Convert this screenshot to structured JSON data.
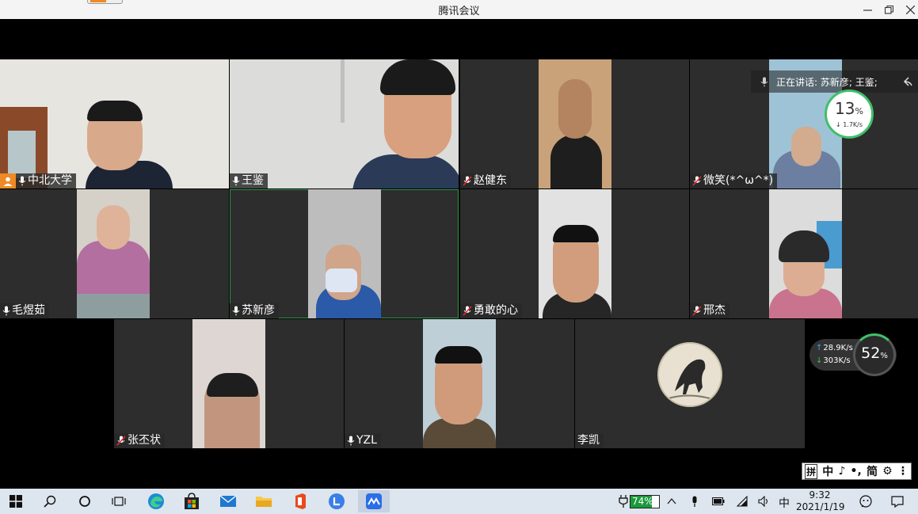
{
  "window": {
    "title": "腾讯会议",
    "controls": [
      "minimize-icon",
      "restore-icon",
      "close-icon"
    ]
  },
  "speaking_banner": {
    "text": "正在讲话: 苏新彦; 王鉴;"
  },
  "network": {
    "cpu_top": {
      "value": "13",
      "unit": "%",
      "rate": "↓ 1.7K/s"
    },
    "upload_rate": "28.9K/s",
    "download_rate": "303K/s",
    "cpu_bottom": {
      "value": "52",
      "unit": "%"
    }
  },
  "participants": [
    {
      "name": "中北大学",
      "host": true,
      "mic": "on"
    },
    {
      "name": "王鉴",
      "mic": "on"
    },
    {
      "name": "赵健东",
      "mic": "off"
    },
    {
      "name": "微笑(*^ω^*)",
      "mic": "off"
    },
    {
      "name": "毛煜茹",
      "mic": "on"
    },
    {
      "name": "苏新彦",
      "mic": "on",
      "active": true
    },
    {
      "name": "勇敢的心",
      "mic": "off"
    },
    {
      "name": "邢杰",
      "mic": "off"
    },
    {
      "name": "张丕状",
      "mic": "off"
    },
    {
      "name": "YZL",
      "mic": "on"
    },
    {
      "name": "李凯",
      "mic": "none",
      "avatar": true
    }
  ],
  "ime": {
    "items": [
      "拼",
      "中",
      "♪",
      "•,",
      "简",
      "⚙",
      "⋮"
    ]
  },
  "taskbar": {
    "battery_percent": 74,
    "battery_label": "74%",
    "ime_lang": "中",
    "time": "9:32",
    "date": "2021/1/19"
  },
  "colors": {
    "host_badge": "#f08a24",
    "active_border": "#2a9a4a",
    "battery_fill": "#1a9a3a"
  }
}
